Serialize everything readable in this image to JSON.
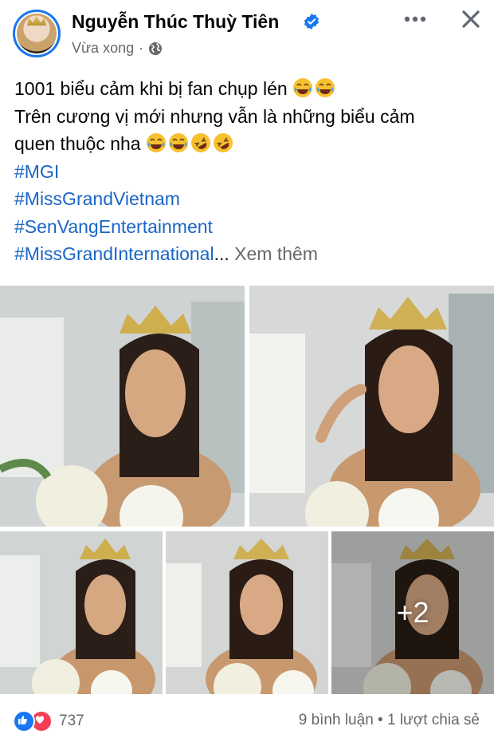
{
  "post": {
    "author": "Nguyễn Thúc Thuỳ Tiên",
    "time": "Vừa xong",
    "separator": "·",
    "icons": {
      "verified": "verified-badge-icon",
      "privacy": "globe-icon",
      "more": "more-options-icon",
      "close": "close-icon"
    },
    "colors": {
      "accent": "#1877f2",
      "hashtag": "#1a65c6",
      "muted": "#65676b"
    }
  },
  "caption": {
    "line1": "1001 biểu cảm khi bị fan chụp lén",
    "line2": "Trên cương vị mới nhưng vẫn là những biểu cảm",
    "line3": "quen thuộc nha",
    "hashtags": [
      "#MGI",
      "#MissGrandVietnam",
      "#SenVangEntertainment",
      "#MissGrandInternational"
    ],
    "ellipsis": "...",
    "see_more": "Xem thêm"
  },
  "photos": {
    "more_count": "+2"
  },
  "footer": {
    "reaction_count": "737",
    "comments": "9 bình luận",
    "dot": "•",
    "shares": "1 lượt chia sẻ"
  }
}
